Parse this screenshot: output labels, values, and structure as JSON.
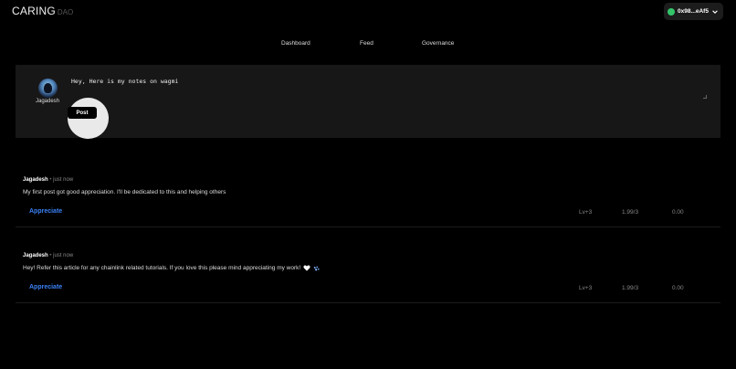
{
  "brand": {
    "name": "CARING",
    "suffix": "DAO"
  },
  "wallet": {
    "address": "0x98...eAf5",
    "status_color": "#33c46a"
  },
  "nav": {
    "items": [
      {
        "label": "Dashboard"
      },
      {
        "label": "Feed"
      },
      {
        "label": "Governance"
      }
    ]
  },
  "composer": {
    "user_name": "Jagadesh",
    "text": "Hey, Here is my notes on wagmi",
    "post_label": "Post"
  },
  "feed": [
    {
      "author": "Jagadesh",
      "separator": "•",
      "time": "just now",
      "body": "My first post got good appreciation. I'll be dedicated to this and helping others",
      "action": "Appreciate",
      "level": "Lv+3",
      "ratio": "1.99/3",
      "amount": "0.00"
    },
    {
      "author": "Jagadesh",
      "separator": "•",
      "time": "just now",
      "body": "Hey! Refer this article for any chainlink related tutorials. If you love this please mind appreciating my work!",
      "action": "Appreciate",
      "level": "Lv+3",
      "ratio": "1.99/3",
      "amount": "0.00",
      "icons": [
        "heart-icon",
        "paws-icon"
      ]
    }
  ],
  "colors": {
    "accent": "#3b82f6",
    "background": "#000000",
    "panel": "#171717"
  }
}
